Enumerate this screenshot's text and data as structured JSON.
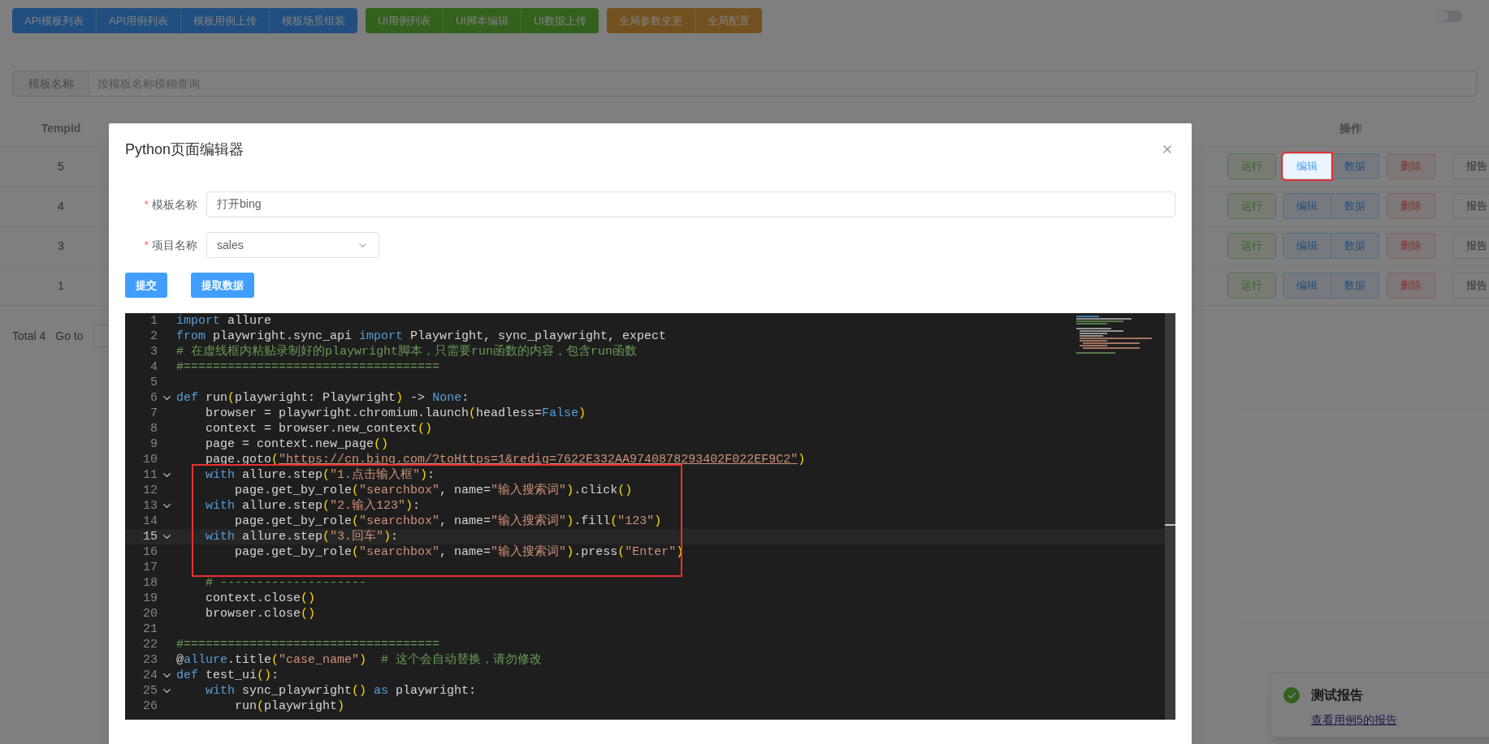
{
  "top_nav": {
    "groups": [
      {
        "kind": "api",
        "buttons": [
          "API模板列表",
          "API用例列表",
          "模板用例上传",
          "模板场景组装"
        ]
      },
      {
        "kind": "ui",
        "buttons": [
          "UI用例列表",
          "UI脚本编辑",
          "UI数据上传"
        ]
      },
      {
        "kind": "global",
        "buttons": [
          "全局参数变更",
          "全局配置"
        ]
      }
    ],
    "toggle": {
      "on": false
    }
  },
  "filter": {
    "label": "模板名称",
    "placeholder": "按模板名称模糊查询"
  },
  "table": {
    "columns": [
      "TempId",
      "操作"
    ],
    "rows": [
      {
        "tempid": "5",
        "actions": [
          {
            "label": "运行",
            "kind": "run",
            "annotated": false
          },
          {
            "label": "编辑",
            "kind": "edit",
            "annotated": true
          },
          {
            "label": "数据",
            "kind": "data",
            "annotated": false
          },
          {
            "label": "删除",
            "kind": "delete",
            "annotated": false
          },
          {
            "label": "报告",
            "kind": "report",
            "annotated": false
          }
        ]
      },
      {
        "tempid": "4",
        "actions": [
          {
            "label": "运行",
            "kind": "run",
            "annotated": false
          },
          {
            "label": "编辑",
            "kind": "edit",
            "annotated": false
          },
          {
            "label": "数据",
            "kind": "data",
            "annotated": false
          },
          {
            "label": "删除",
            "kind": "delete",
            "annotated": false
          },
          {
            "label": "报告",
            "kind": "report",
            "annotated": false
          }
        ]
      },
      {
        "tempid": "3",
        "actions": [
          {
            "label": "运行",
            "kind": "run",
            "annotated": false
          },
          {
            "label": "编辑",
            "kind": "edit",
            "annotated": false
          },
          {
            "label": "数据",
            "kind": "data",
            "annotated": false
          },
          {
            "label": "删除",
            "kind": "delete",
            "annotated": false
          },
          {
            "label": "报告",
            "kind": "report",
            "annotated": false
          }
        ]
      },
      {
        "tempid": "1",
        "actions": [
          {
            "label": "运行",
            "kind": "run",
            "annotated": false
          },
          {
            "label": "编辑",
            "kind": "edit",
            "annotated": false
          },
          {
            "label": "数据",
            "kind": "data",
            "annotated": false
          },
          {
            "label": "删除",
            "kind": "delete",
            "annotated": false
          },
          {
            "label": "报告",
            "kind": "report",
            "annotated": false
          }
        ]
      }
    ]
  },
  "pagination": {
    "total": "Total 4",
    "goto": "Go to"
  },
  "toast": {
    "title": "测试报告",
    "link": "查看用例5的报告"
  },
  "dialog": {
    "title": "Python页面编辑器",
    "fields": [
      {
        "kind": "input",
        "required_mark": "*",
        "label": "模板名称",
        "value": "打开bing"
      },
      {
        "kind": "select",
        "required_mark": "*",
        "label": "项目名称",
        "value": "sales"
      }
    ],
    "buttons": [
      "提交",
      "提取数据"
    ],
    "code": {
      "blocks": [
        {
          "boxed": false,
          "lines": [
            {
              "n": "1",
              "fold": false,
              "current": false,
              "tokens": [
                {
                  "kind": "kw",
                  "t": "import"
                },
                {
                  "kind": "tx",
                  "t": " allure"
                }
              ]
            },
            {
              "n": "2",
              "fold": false,
              "current": false,
              "tokens": [
                {
                  "kind": "kw",
                  "t": "from"
                },
                {
                  "kind": "tx",
                  "t": " playwright.sync_api "
                },
                {
                  "kind": "kw",
                  "t": "import"
                },
                {
                  "kind": "tx",
                  "t": " Playwright, sync_playwright, expect"
                }
              ]
            },
            {
              "n": "3",
              "fold": false,
              "current": false,
              "tokens": [
                {
                  "kind": "cm",
                  "t": "# 在虚线框内粘贴录制好的playwright脚本，只需要run函数的内容，包含run函数"
                }
              ]
            },
            {
              "n": "4",
              "fold": false,
              "current": false,
              "tokens": [
                {
                  "kind": "cm",
                  "t": "#==================================="
                }
              ]
            },
            {
              "n": "5",
              "fold": false,
              "current": false
            },
            {
              "n": "6",
              "fold": true,
              "current": false,
              "tokens": [
                {
                  "kind": "kw",
                  "t": "def"
                },
                {
                  "kind": "tx",
                  "t": " run"
                },
                {
                  "kind": "br",
                  "t": "("
                },
                {
                  "kind": "tx",
                  "t": "playwright: Playwright"
                },
                {
                  "kind": "br",
                  "t": ")"
                },
                {
                  "kind": "tx",
                  "t": " -> "
                },
                {
                  "kind": "kw",
                  "t": "None"
                },
                {
                  "kind": "tx",
                  "t": ":"
                }
              ]
            },
            {
              "n": "7",
              "fold": false,
              "current": false,
              "tokens": [
                {
                  "kind": "tx",
                  "t": "    browser = playwright.chromium.launch"
                },
                {
                  "kind": "br",
                  "t": "("
                },
                {
                  "kind": "tx",
                  "t": "headless="
                },
                {
                  "kind": "kw",
                  "t": "False"
                },
                {
                  "kind": "br",
                  "t": ")"
                }
              ]
            },
            {
              "n": "8",
              "fold": false,
              "current": false,
              "tokens": [
                {
                  "kind": "tx",
                  "t": "    context = browser.new_context"
                },
                {
                  "kind": "br",
                  "t": "()"
                }
              ]
            },
            {
              "n": "9",
              "fold": false,
              "current": false,
              "tokens": [
                {
                  "kind": "tx",
                  "t": "    page = context.new_page"
                },
                {
                  "kind": "br",
                  "t": "()"
                }
              ]
            },
            {
              "n": "10",
              "fold": false,
              "current": false,
              "tokens": [
                {
                  "kind": "tx",
                  "t": "    page.goto"
                },
                {
                  "kind": "br",
                  "t": "("
                },
                {
                  "kind": "url",
                  "t": "\"https://cn.bing.com/?toHttps=1&redig=7622E332AA9740878293402F022EF9C2\""
                },
                {
                  "kind": "br",
                  "t": ")"
                }
              ]
            }
          ]
        },
        {
          "boxed": true,
          "lines": [
            {
              "n": "11",
              "fold": true,
              "current": false,
              "tokens": [
                {
                  "kind": "kw",
                  "t": "    with"
                },
                {
                  "kind": "tx",
                  "t": " allure.step"
                },
                {
                  "kind": "br",
                  "t": "("
                },
                {
                  "kind": "str",
                  "t": "\"1.点击输入框\""
                },
                {
                  "kind": "br",
                  "t": ")"
                },
                {
                  "kind": "tx",
                  "t": ":"
                }
              ]
            },
            {
              "n": "12",
              "fold": false,
              "current": false,
              "tokens": [
                {
                  "kind": "tx",
                  "t": "        page.get_by_role"
                },
                {
                  "kind": "br",
                  "t": "("
                },
                {
                  "kind": "str",
                  "t": "\"searchbox\""
                },
                {
                  "kind": "tx",
                  "t": ", name="
                },
                {
                  "kind": "str",
                  "t": "\"输入搜索词\""
                },
                {
                  "kind": "br",
                  "t": ")"
                },
                {
                  "kind": "tx",
                  "t": ".click"
                },
                {
                  "kind": "br",
                  "t": "()"
                }
              ]
            },
            {
              "n": "13",
              "fold": true,
              "current": false,
              "tokens": [
                {
                  "kind": "kw",
                  "t": "    with"
                },
                {
                  "kind": "tx",
                  "t": " allure.step"
                },
                {
                  "kind": "br",
                  "t": "("
                },
                {
                  "kind": "str",
                  "t": "\"2.输入123\""
                },
                {
                  "kind": "br",
                  "t": ")"
                },
                {
                  "kind": "tx",
                  "t": ":"
                }
              ]
            },
            {
              "n": "14",
              "fold": false,
              "current": false,
              "tokens": [
                {
                  "kind": "tx",
                  "t": "        page.get_by_role"
                },
                {
                  "kind": "br",
                  "t": "("
                },
                {
                  "kind": "str",
                  "t": "\"searchbox\""
                },
                {
                  "kind": "tx",
                  "t": ", name="
                },
                {
                  "kind": "str",
                  "t": "\"输入搜索词\""
                },
                {
                  "kind": "br",
                  "t": ")"
                },
                {
                  "kind": "tx",
                  "t": ".fill"
                },
                {
                  "kind": "br",
                  "t": "("
                },
                {
                  "kind": "str",
                  "t": "\"123\""
                },
                {
                  "kind": "br",
                  "t": ")"
                }
              ]
            },
            {
              "n": "15",
              "fold": true,
              "current": true,
              "tokens": [
                {
                  "kind": "kw",
                  "t": "    with"
                },
                {
                  "kind": "tx",
                  "t": " allure.step"
                },
                {
                  "kind": "br",
                  "t": "("
                },
                {
                  "kind": "str",
                  "t": "\"3.回车\""
                },
                {
                  "kind": "br",
                  "t": ")"
                },
                {
                  "kind": "tx",
                  "t": ":"
                }
              ]
            },
            {
              "n": "16",
              "fold": false,
              "current": false,
              "tokens": [
                {
                  "kind": "tx",
                  "t": "        page.get_by_role"
                },
                {
                  "kind": "br",
                  "t": "("
                },
                {
                  "kind": "str",
                  "t": "\"searchbox\""
                },
                {
                  "kind": "tx",
                  "t": ", name="
                },
                {
                  "kind": "str",
                  "t": "\"输入搜索词\""
                },
                {
                  "kind": "br",
                  "t": ")"
                },
                {
                  "kind": "tx",
                  "t": ".press"
                },
                {
                  "kind": "br",
                  "t": "("
                },
                {
                  "kind": "str",
                  "t": "\"Enter\""
                },
                {
                  "kind": "br",
                  "t": ")"
                }
              ]
            },
            {
              "n": "17",
              "fold": false,
              "current": false
            }
          ]
        },
        {
          "boxed": false,
          "lines": [
            {
              "n": "18",
              "fold": false,
              "current": false,
              "tokens": [
                {
                  "kind": "cm",
                  "t": "    # --------------------"
                }
              ]
            },
            {
              "n": "19",
              "fold": false,
              "current": false,
              "tokens": [
                {
                  "kind": "tx",
                  "t": "    context.close"
                },
                {
                  "kind": "br",
                  "t": "()"
                }
              ]
            },
            {
              "n": "20",
              "fold": false,
              "current": false,
              "tokens": [
                {
                  "kind": "tx",
                  "t": "    browser.close"
                },
                {
                  "kind": "br",
                  "t": "()"
                }
              ]
            },
            {
              "n": "21",
              "fold": false,
              "current": false
            },
            {
              "n": "22",
              "fold": false,
              "current": false,
              "tokens": [
                {
                  "kind": "cm",
                  "t": "#==================================="
                }
              ]
            },
            {
              "n": "23",
              "fold": false,
              "current": false,
              "tokens": [
                {
                  "kind": "tx",
                  "t": "@"
                },
                {
                  "kind": "kw",
                  "t": "allure"
                },
                {
                  "kind": "tx",
                  "t": ".title"
                },
                {
                  "kind": "br",
                  "t": "("
                },
                {
                  "kind": "str",
                  "t": "\"case_name\""
                },
                {
                  "kind": "br",
                  "t": ")"
                },
                {
                  "kind": "cm",
                  "t": "  # 这个会自动替换，请勿修改"
                }
              ]
            },
            {
              "n": "24",
              "fold": true,
              "current": false,
              "tokens": [
                {
                  "kind": "kw",
                  "t": "def"
                },
                {
                  "kind": "tx",
                  "t": " test_ui"
                },
                {
                  "kind": "br",
                  "t": "()"
                },
                {
                  "kind": "tx",
                  "t": ":"
                }
              ]
            },
            {
              "n": "25",
              "fold": true,
              "current": false,
              "tokens": [
                {
                  "kind": "kw",
                  "t": "    with"
                },
                {
                  "kind": "tx",
                  "t": " sync_playwright"
                },
                {
                  "kind": "br",
                  "t": "()"
                },
                {
                  "kind": "kw",
                  "t": " as"
                },
                {
                  "kind": "tx",
                  "t": " playwright:"
                }
              ]
            },
            {
              "n": "26",
              "fold": false,
              "current": false,
              "tokens": [
                {
                  "kind": "tx",
                  "t": "        run"
                },
                {
                  "kind": "br",
                  "t": "("
                },
                {
                  "kind": "tx",
                  "t": "playwright"
                },
                {
                  "kind": "br",
                  "t": ")"
                }
              ]
            }
          ]
        }
      ]
    }
  }
}
